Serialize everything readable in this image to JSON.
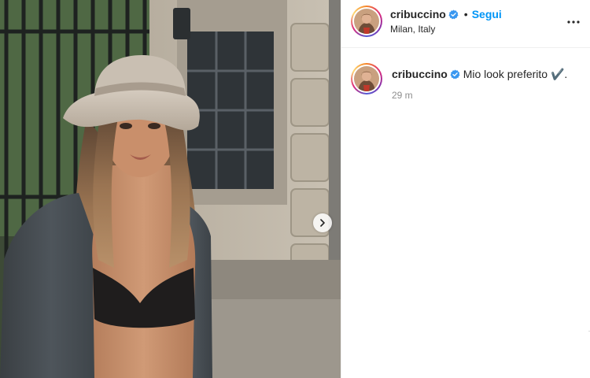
{
  "header": {
    "username": "cribuccino",
    "separator": "•",
    "follow_label": "Segui",
    "location": "Milan, Italy",
    "more_icon": "more-horizontal-icon"
  },
  "caption": {
    "username": "cribuccino",
    "text": "Mio look preferito ✔️.",
    "time": "29 m"
  },
  "media": {
    "next_icon": "chevron-right-icon",
    "slide_count": 2,
    "active_slide": 1
  },
  "colors": {
    "link_blue": "#0095f6",
    "verified_blue": "#3897f0",
    "text": "#262626",
    "muted": "#8e8e8e",
    "border": "#efefef"
  }
}
